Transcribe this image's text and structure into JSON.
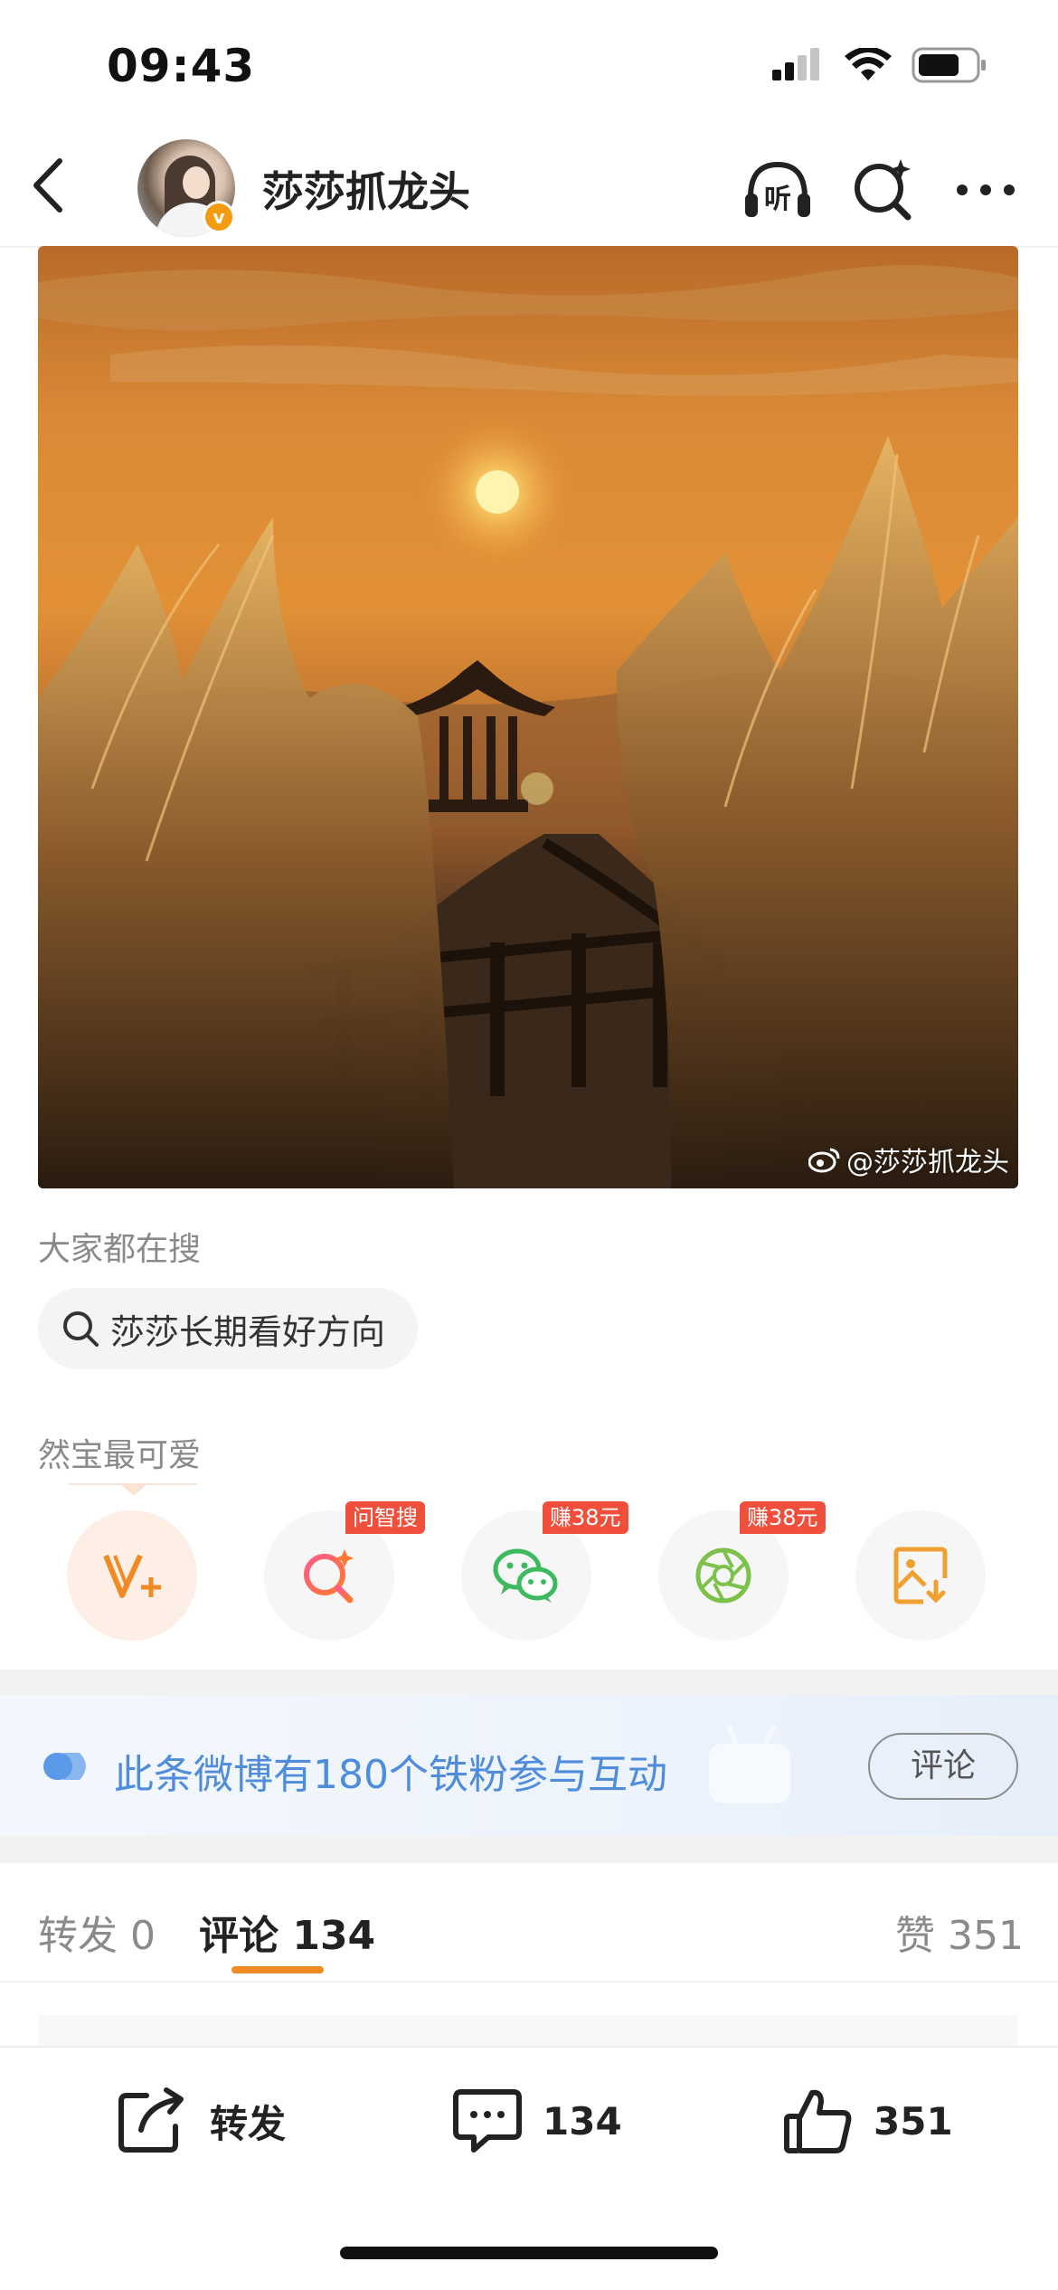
{
  "status_bar": {
    "time": "09:43"
  },
  "header": {
    "username": "莎莎抓龙头",
    "verified_mark": "v",
    "listen_label": "听"
  },
  "post": {
    "watermark": "@莎莎抓龙头"
  },
  "search": {
    "heading": "大家都在搜",
    "chip_text": "莎莎长期看好方向"
  },
  "user_tag": "然宝最可爱",
  "actions": [
    {
      "icon": "vplus-icon",
      "badge": ""
    },
    {
      "icon": "ai-search-icon",
      "badge": "问智搜"
    },
    {
      "icon": "wechat-icon",
      "badge": "赚38元"
    },
    {
      "icon": "moments-icon",
      "badge": "赚38元"
    },
    {
      "icon": "save-image-icon",
      "badge": ""
    }
  ],
  "fan_banner": {
    "text": "此条微博有180个铁粉参与互动",
    "button": "评论"
  },
  "tabs": {
    "repost": "转发",
    "repost_count": "0",
    "comment": "评论",
    "comment_count": "134",
    "like": "赞",
    "like_count": "351"
  },
  "bottom_bar": {
    "repost": "转发",
    "comment_count": "134",
    "like_count": "351"
  },
  "colors": {
    "accent": "#f08a24",
    "badge_red": "#ef4f3b",
    "link_blue": "#4f8ddc",
    "wechat_green": "#3dba5f",
    "moments_green": "#7cc24a"
  }
}
